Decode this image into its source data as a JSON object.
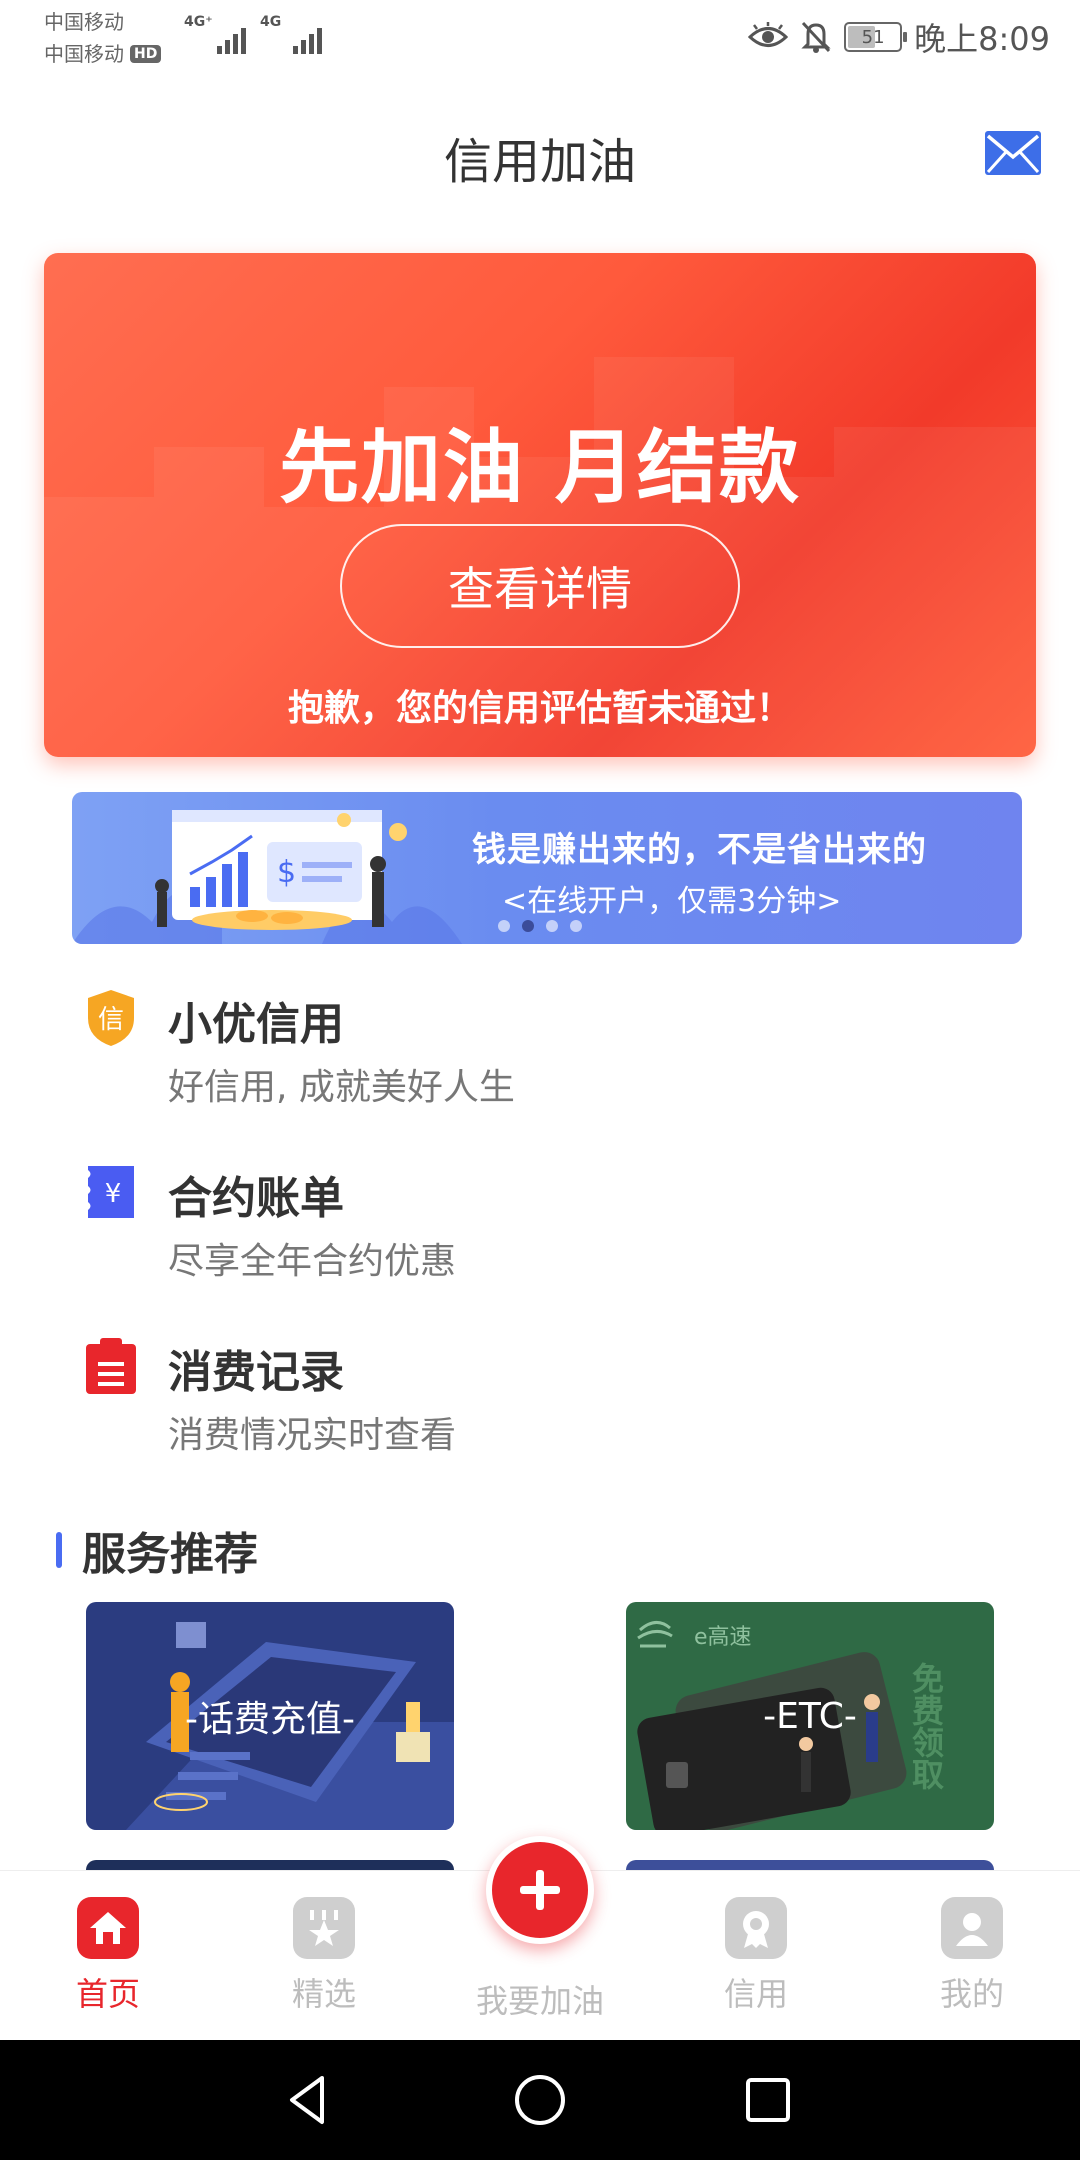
{
  "status_bar": {
    "carrier_1": "中国移动",
    "carrier_2": "中国移动",
    "hd_badge": "HD",
    "signal_1_label": "4G⁺",
    "signal_2_label": "4G",
    "battery_level": "51",
    "time": "晚上8:09"
  },
  "header": {
    "title": "信用加油"
  },
  "hero": {
    "headline": "先加油 月结款",
    "button_label": "查看详情",
    "note": "抱歉，您的信用评估暂未通过！"
  },
  "banner": {
    "line1": "钱是赚出来的，不是省出来的",
    "line2": "<在线开户，仅需3分钟>",
    "dots_count": 4,
    "active_dot": 2
  },
  "features": [
    {
      "icon_text": "信",
      "title": "小优信用",
      "subtitle": "好信用, 成就美好人生"
    },
    {
      "icon_text": "¥",
      "title": "合约账单",
      "subtitle": "尽享全年合约优惠"
    },
    {
      "icon_text": "",
      "title": "消费记录",
      "subtitle": "消费情况实时查看"
    }
  ],
  "services_section": {
    "title": "服务推荐",
    "cards": [
      {
        "label": "-话费充值-"
      },
      {
        "label": "-ETC-",
        "brand_text": "e高速",
        "side_text": "免费领取"
      }
    ]
  },
  "tabbar": {
    "tabs": [
      {
        "label": "首页",
        "active": true
      },
      {
        "label": "精选",
        "active": false
      },
      {
        "label": "我要加油",
        "active": false
      },
      {
        "label": "信用",
        "active": false
      },
      {
        "label": "我的",
        "active": false
      }
    ]
  },
  "colors": {
    "accent_red": "#e8262c",
    "hero_orange": "#ff5a3c",
    "banner_blue": "#6a8cf0",
    "etc_green": "#2f6a45",
    "phone_navy": "#2b3c80"
  }
}
